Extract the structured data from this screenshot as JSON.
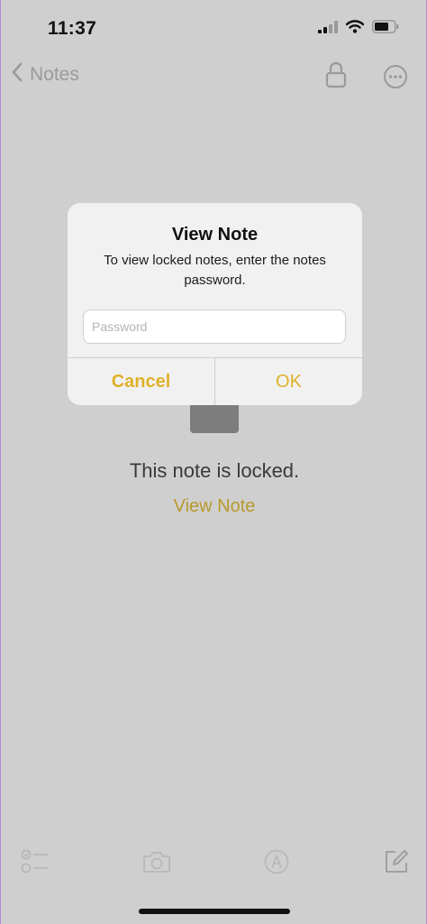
{
  "status_bar": {
    "time": "11:37",
    "icons": [
      "signal-bars-icon",
      "wifi-icon",
      "battery-icon"
    ]
  },
  "nav": {
    "back_label": "Notes",
    "icons": [
      "chevron-left-icon",
      "lock-icon",
      "more-icon"
    ]
  },
  "note": {
    "locked_message": "This note is locked.",
    "view_link": "View Note"
  },
  "alert": {
    "title": "View Note",
    "message": "To view locked notes, enter the notes password.",
    "password_placeholder": "Password",
    "password_value": "",
    "cancel_label": "Cancel",
    "ok_label": "OK"
  },
  "toolbar": {
    "icons": [
      "checklist-icon",
      "camera-icon",
      "markup-icon",
      "compose-icon"
    ]
  },
  "colors": {
    "accent": "#e0b12a",
    "dimmed_accent": "#b89a2a",
    "background_dim": "#cfcfcf",
    "alert_background": "#f1f1f1"
  }
}
